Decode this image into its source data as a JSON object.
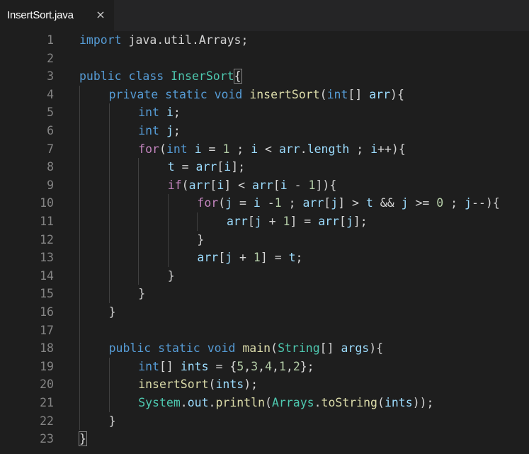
{
  "tab": {
    "filename": "InsertSort.java",
    "close_glyph": "×"
  },
  "colors": {
    "keyword": "#569cd6",
    "control": "#c586c0",
    "type": "#4ec9b0",
    "function": "#dcdcaa",
    "variable": "#9cdcfe",
    "number": "#b5cea8",
    "plain": "#d4d4d4",
    "line_number": "#858585",
    "background": "#1e1e1e"
  },
  "lines": [
    {
      "n": "1",
      "indent": 0,
      "tokens": [
        [
          "kw",
          "import"
        ],
        [
          "pl",
          " java.util.Arrays;"
        ]
      ]
    },
    {
      "n": "2",
      "indent": 0,
      "tokens": []
    },
    {
      "n": "3",
      "indent": 0,
      "tokens": [
        [
          "kw",
          "public"
        ],
        [
          "pl",
          " "
        ],
        [
          "kw",
          "class"
        ],
        [
          "pl",
          " "
        ],
        [
          "ty",
          "InserSort"
        ],
        [
          "bracket",
          "{"
        ]
      ]
    },
    {
      "n": "4",
      "indent": 1,
      "tokens": [
        [
          "kw",
          "private"
        ],
        [
          "pl",
          " "
        ],
        [
          "kw",
          "static"
        ],
        [
          "pl",
          " "
        ],
        [
          "kw",
          "void"
        ],
        [
          "pl",
          " "
        ],
        [
          "fn",
          "insertSort"
        ],
        [
          "pl",
          "("
        ],
        [
          "kw",
          "int"
        ],
        [
          "pl",
          "[] "
        ],
        [
          "var",
          "arr"
        ],
        [
          "pl",
          "){"
        ]
      ]
    },
    {
      "n": "5",
      "indent": 2,
      "tokens": [
        [
          "kw",
          "int"
        ],
        [
          "pl",
          " "
        ],
        [
          "var",
          "i"
        ],
        [
          "pl",
          ";"
        ]
      ]
    },
    {
      "n": "6",
      "indent": 2,
      "tokens": [
        [
          "kw",
          "int"
        ],
        [
          "pl",
          " "
        ],
        [
          "var",
          "j"
        ],
        [
          "pl",
          ";"
        ]
      ]
    },
    {
      "n": "7",
      "indent": 2,
      "tokens": [
        [
          "ctl",
          "for"
        ],
        [
          "pl",
          "("
        ],
        [
          "kw",
          "int"
        ],
        [
          "pl",
          " "
        ],
        [
          "var",
          "i"
        ],
        [
          "pl",
          " = "
        ],
        [
          "num",
          "1"
        ],
        [
          "pl",
          " ; "
        ],
        [
          "var",
          "i"
        ],
        [
          "pl",
          " < "
        ],
        [
          "var",
          "arr"
        ],
        [
          "pl",
          "."
        ],
        [
          "var",
          "length"
        ],
        [
          "pl",
          " ; "
        ],
        [
          "var",
          "i"
        ],
        [
          "pl",
          "++){"
        ]
      ]
    },
    {
      "n": "8",
      "indent": 3,
      "tokens": [
        [
          "var",
          "t"
        ],
        [
          "pl",
          " = "
        ],
        [
          "var",
          "arr"
        ],
        [
          "pl",
          "["
        ],
        [
          "var",
          "i"
        ],
        [
          "pl",
          "];"
        ]
      ]
    },
    {
      "n": "9",
      "indent": 3,
      "tokens": [
        [
          "ctl",
          "if"
        ],
        [
          "pl",
          "("
        ],
        [
          "var",
          "arr"
        ],
        [
          "pl",
          "["
        ],
        [
          "var",
          "i"
        ],
        [
          "pl",
          "] < "
        ],
        [
          "var",
          "arr"
        ],
        [
          "pl",
          "["
        ],
        [
          "var",
          "i"
        ],
        [
          "pl",
          " - "
        ],
        [
          "num",
          "1"
        ],
        [
          "pl",
          "]){"
        ]
      ]
    },
    {
      "n": "10",
      "indent": 4,
      "tokens": [
        [
          "ctl",
          "for"
        ],
        [
          "pl",
          "("
        ],
        [
          "var",
          "j"
        ],
        [
          "pl",
          " = "
        ],
        [
          "var",
          "i"
        ],
        [
          "pl",
          " -"
        ],
        [
          "num",
          "1"
        ],
        [
          "pl",
          " ; "
        ],
        [
          "var",
          "arr"
        ],
        [
          "pl",
          "["
        ],
        [
          "var",
          "j"
        ],
        [
          "pl",
          "] > "
        ],
        [
          "var",
          "t"
        ],
        [
          "pl",
          " && "
        ],
        [
          "var",
          "j"
        ],
        [
          "pl",
          " >= "
        ],
        [
          "num",
          "0"
        ],
        [
          "pl",
          " ; "
        ],
        [
          "var",
          "j"
        ],
        [
          "pl",
          "--){"
        ]
      ]
    },
    {
      "n": "11",
      "indent": 5,
      "tokens": [
        [
          "var",
          "arr"
        ],
        [
          "pl",
          "["
        ],
        [
          "var",
          "j"
        ],
        [
          "pl",
          " + "
        ],
        [
          "num",
          "1"
        ],
        [
          "pl",
          "] = "
        ],
        [
          "var",
          "arr"
        ],
        [
          "pl",
          "["
        ],
        [
          "var",
          "j"
        ],
        [
          "pl",
          "];"
        ]
      ]
    },
    {
      "n": "12",
      "indent": 4,
      "tokens": [
        [
          "pl",
          "}"
        ]
      ]
    },
    {
      "n": "13",
      "indent": 4,
      "tokens": [
        [
          "var",
          "arr"
        ],
        [
          "pl",
          "["
        ],
        [
          "var",
          "j"
        ],
        [
          "pl",
          " + "
        ],
        [
          "num",
          "1"
        ],
        [
          "pl",
          "] = "
        ],
        [
          "var",
          "t"
        ],
        [
          "pl",
          ";"
        ]
      ]
    },
    {
      "n": "14",
      "indent": 3,
      "tokens": [
        [
          "pl",
          "}"
        ]
      ]
    },
    {
      "n": "15",
      "indent": 2,
      "tokens": [
        [
          "pl",
          "}"
        ]
      ]
    },
    {
      "n": "16",
      "indent": 1,
      "tokens": [
        [
          "pl",
          "}"
        ]
      ]
    },
    {
      "n": "17",
      "indent": 0,
      "tokens": []
    },
    {
      "n": "18",
      "indent": 1,
      "tokens": [
        [
          "kw",
          "public"
        ],
        [
          "pl",
          " "
        ],
        [
          "kw",
          "static"
        ],
        [
          "pl",
          " "
        ],
        [
          "kw",
          "void"
        ],
        [
          "pl",
          " "
        ],
        [
          "fn",
          "main"
        ],
        [
          "pl",
          "("
        ],
        [
          "ty",
          "String"
        ],
        [
          "pl",
          "[] "
        ],
        [
          "var",
          "args"
        ],
        [
          "pl",
          "){"
        ]
      ]
    },
    {
      "n": "19",
      "indent": 2,
      "tokens": [
        [
          "kw",
          "int"
        ],
        [
          "pl",
          "[] "
        ],
        [
          "var",
          "ints"
        ],
        [
          "pl",
          " = {"
        ],
        [
          "num",
          "5"
        ],
        [
          "pl",
          ","
        ],
        [
          "num",
          "3"
        ],
        [
          "pl",
          ","
        ],
        [
          "num",
          "4"
        ],
        [
          "pl",
          ","
        ],
        [
          "num",
          "1"
        ],
        [
          "pl",
          ","
        ],
        [
          "num",
          "2"
        ],
        [
          "pl",
          "};"
        ]
      ]
    },
    {
      "n": "20",
      "indent": 2,
      "tokens": [
        [
          "fn",
          "insertSort"
        ],
        [
          "pl",
          "("
        ],
        [
          "var",
          "ints"
        ],
        [
          "pl",
          ");"
        ]
      ]
    },
    {
      "n": "21",
      "indent": 2,
      "tokens": [
        [
          "ty",
          "System"
        ],
        [
          "pl",
          "."
        ],
        [
          "var",
          "out"
        ],
        [
          "pl",
          "."
        ],
        [
          "fn",
          "println"
        ],
        [
          "pl",
          "("
        ],
        [
          "ty",
          "Arrays"
        ],
        [
          "pl",
          "."
        ],
        [
          "fn",
          "toString"
        ],
        [
          "pl",
          "("
        ],
        [
          "var",
          "ints"
        ],
        [
          "pl",
          "));"
        ]
      ]
    },
    {
      "n": "22",
      "indent": 1,
      "tokens": [
        [
          "pl",
          "}"
        ]
      ]
    },
    {
      "n": "23",
      "indent": 0,
      "tokens": [
        [
          "bracket",
          "}"
        ]
      ]
    }
  ]
}
